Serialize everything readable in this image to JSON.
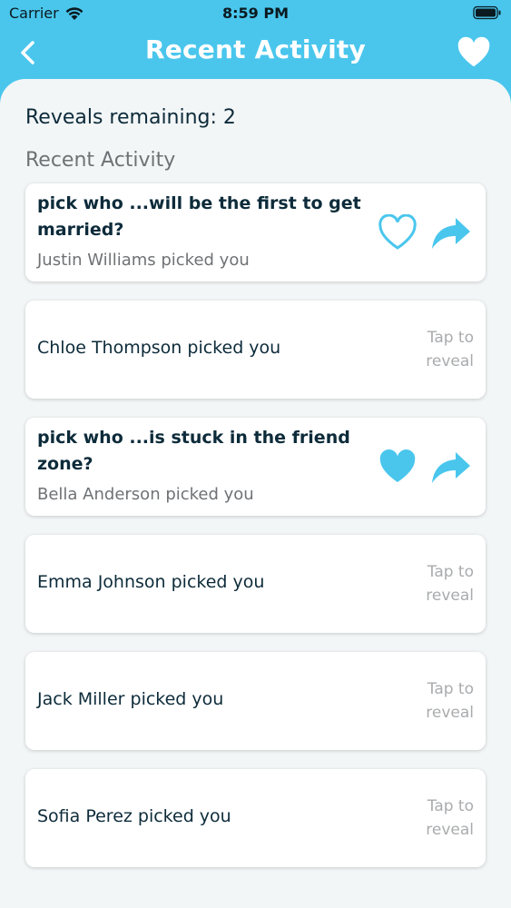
{
  "status": {
    "carrier": "Carrier",
    "time": "8:59 PM"
  },
  "nav": {
    "title": "Recent Activity"
  },
  "reveals": "Reveals remaining: 2",
  "section_title": "Recent Activity",
  "colors": {
    "accent": "#4ac6ed",
    "text": "#0d2b3a",
    "muted": "#6f7275"
  },
  "activity": [
    {
      "type": "question",
      "question": "pick who ...will be the first to get married?",
      "subtitle": "Justin Williams picked you",
      "liked": false
    },
    {
      "type": "hidden",
      "name": "Chloe Thompson picked you",
      "tap": "Tap to reveal"
    },
    {
      "type": "question",
      "question": "pick who ...is stuck in the friend zone?",
      "subtitle": "Bella Anderson picked you",
      "liked": true
    },
    {
      "type": "hidden",
      "name": "Emma Johnson picked you",
      "tap": "Tap to reveal"
    },
    {
      "type": "hidden",
      "name": "Jack Miller picked you",
      "tap": "Tap to reveal"
    },
    {
      "type": "hidden",
      "name": "Sofia Perez picked you",
      "tap": "Tap to reveal"
    }
  ]
}
